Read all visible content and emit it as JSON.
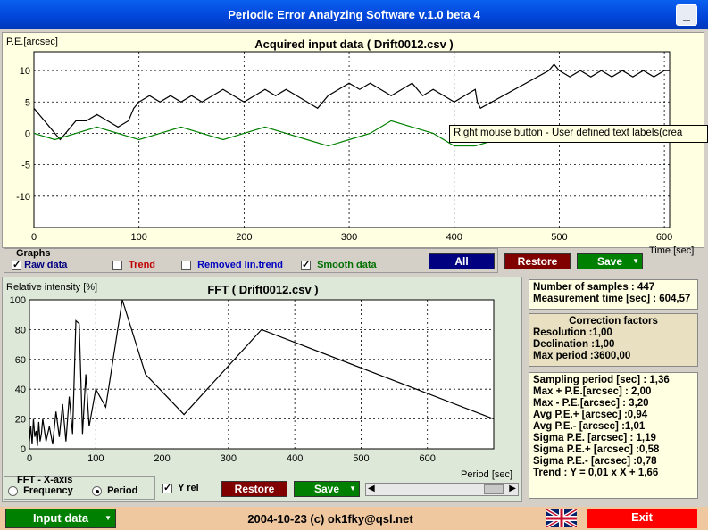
{
  "window": {
    "title": "Periodic Error Analyzing Software v.1.0 beta 4",
    "minimize_label": "_"
  },
  "top_chart": {
    "title": "Acquired input data ( Drift0012.csv )",
    "ylabel": "P.E.[arcsec]",
    "xlabel": "Time [sec]",
    "tooltip": "Right mouse button - User defined text labels(crea"
  },
  "graphs": {
    "label": "Graphs",
    "items": [
      {
        "label": "Raw data",
        "checked": true,
        "color": "#000080"
      },
      {
        "label": "Trend",
        "checked": false,
        "color": "#c00000"
      },
      {
        "label": "Removed lin.trend",
        "checked": false,
        "color": "#0000c0"
      },
      {
        "label": "Smooth data",
        "checked": true,
        "color": "#007000"
      }
    ],
    "all_label": "All",
    "restore_label": "Restore",
    "save_label": "Save"
  },
  "fft_chart": {
    "title": "FFT ( Drift0012.csv )",
    "ylabel": "Relative intensity [%]",
    "xlabel": "Period [sec]"
  },
  "fft_controls": {
    "xaxis_label": "FFT - X-axis",
    "frequency_label": "Frequency",
    "period_label": "Period",
    "yrel_label": "Y rel",
    "restore_label": "Restore",
    "save_label": "Save"
  },
  "info": {
    "samples": "Number of samples : 447",
    "measurement_time": "Measurement time [sec] : 604,57",
    "correction_title": "Correction factors",
    "resolution": "Resolution :1,00",
    "declination": "Declination :1,00",
    "max_period": "Max period :3600,00",
    "stats": [
      "Sampling period [sec] : 1,36",
      "Max + P.E.[arcsec] : 2,00",
      "Max - P.E.[arcsec] : 3,20",
      "Avg P.E.+ [arcsec] :0,94",
      "Avg P.E.- [arcsec] :1,01",
      "Sigma P.E. [arcsec] : 1,19",
      "Sigma P.E.+ [arcsec] :0,58",
      "Sigma P.E.- [arcsec] :0,78",
      "Trend : Y = 0,01 x X + 1,66"
    ]
  },
  "footer": {
    "input_data_label": "Input data",
    "copyright": "2004-10-23 (c) ok1fky@qsl.net",
    "exit_label": "Exit"
  },
  "chart_data": [
    {
      "type": "line",
      "title": "Acquired input data ( Drift0012.csv )",
      "xlabel": "Time [sec]",
      "ylabel": "P.E.[arcsec]",
      "xlim": [
        0,
        605
      ],
      "ylim": [
        -15,
        13
      ],
      "x_ticks": [
        0,
        100,
        200,
        300,
        400,
        500,
        600
      ],
      "y_ticks": [
        10,
        5,
        0,
        -5,
        -10
      ],
      "grid": true,
      "series": [
        {
          "name": "Raw data",
          "color": "#000000",
          "x": [
            0,
            5,
            10,
            15,
            20,
            25,
            30,
            35,
            40,
            50,
            60,
            70,
            80,
            90,
            95,
            100,
            110,
            120,
            130,
            140,
            150,
            160,
            170,
            180,
            190,
            200,
            210,
            220,
            230,
            240,
            250,
            260,
            270,
            280,
            290,
            300,
            310,
            320,
            330,
            340,
            350,
            360,
            370,
            380,
            390,
            400,
            410,
            420,
            422,
            425,
            490,
            495,
            500,
            510,
            520,
            530,
            540,
            550,
            560,
            570,
            580,
            590,
            600,
            605
          ],
          "y": [
            4,
            3,
            2,
            1,
            0,
            -1,
            0,
            1,
            2,
            2,
            3,
            2,
            1,
            2,
            4,
            5,
            6,
            5,
            6,
            5,
            6,
            5,
            6,
            7,
            6,
            5,
            6,
            7,
            6,
            7,
            6,
            5,
            4,
            6,
            7,
            8,
            7,
            8,
            7,
            6,
            7,
            8,
            6,
            7,
            6,
            5,
            6,
            7,
            5,
            4,
            10,
            11,
            10,
            9,
            10,
            9,
            10,
            9,
            10,
            9,
            10,
            9,
            10,
            10
          ]
        },
        {
          "name": "Smooth data",
          "color": "#008000",
          "x": [
            0,
            20,
            40,
            60,
            80,
            100,
            120,
            140,
            160,
            180,
            200,
            220,
            240,
            260,
            280,
            300,
            320,
            340,
            360,
            380,
            400,
            420,
            440,
            460,
            480,
            500,
            520,
            540,
            560,
            580,
            600
          ],
          "y": [
            0,
            -1,
            0,
            1,
            0,
            -1,
            0,
            1,
            0,
            -1,
            0,
            1,
            0,
            -1,
            -2,
            -1,
            0,
            2,
            1,
            0,
            -2,
            -2,
            -1,
            -1,
            0,
            1,
            0,
            -1,
            0,
            1,
            0
          ]
        }
      ]
    },
    {
      "type": "line",
      "title": "FFT ( Drift0012.csv )",
      "xlabel": "Period [sec]",
      "ylabel": "Relative intensity [%]",
      "xlim": [
        0,
        700
      ],
      "ylim": [
        0,
        100
      ],
      "x_ticks": [
        0,
        100,
        200,
        300,
        400,
        500,
        600
      ],
      "y_ticks": [
        0,
        20,
        40,
        60,
        80,
        100
      ],
      "grid": true,
      "series": [
        {
          "color": "#000000",
          "x": [
            0,
            2,
            4,
            6,
            8,
            10,
            12,
            14,
            16,
            18,
            20,
            25,
            30,
            35,
            40,
            45,
            50,
            55,
            60,
            65,
            70,
            75,
            80,
            85,
            90,
            100,
            115,
            140,
            175,
            233,
            350,
            700
          ],
          "y": [
            5,
            15,
            3,
            20,
            8,
            12,
            2,
            18,
            5,
            10,
            20,
            5,
            15,
            3,
            25,
            8,
            30,
            5,
            35,
            10,
            86,
            84,
            10,
            50,
            15,
            40,
            28,
            100,
            50,
            23,
            80,
            20
          ]
        }
      ]
    }
  ]
}
